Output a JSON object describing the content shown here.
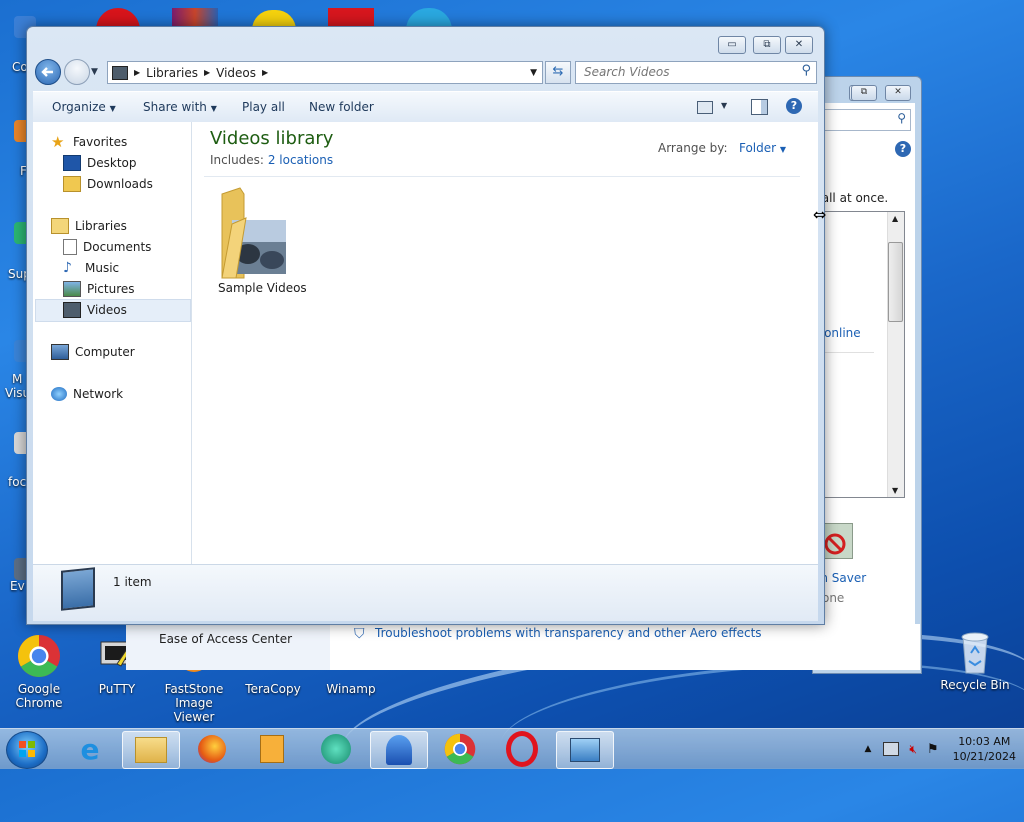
{
  "desktop": {
    "icons": [
      {
        "label": "Google\nChrome",
        "name": "google-chrome"
      },
      {
        "label": "PuTTY",
        "name": "putty"
      },
      {
        "label": "FastStone\nImage Viewer",
        "name": "faststone-image-viewer"
      },
      {
        "label": "TeraCopy",
        "name": "teracopy"
      },
      {
        "label": "Winamp",
        "name": "winamp"
      },
      {
        "label": "Recycle Bin",
        "name": "recycle-bin"
      }
    ],
    "edge_labels": [
      "Co",
      "F",
      "Sup",
      "M",
      "Visu",
      "foc",
      "Ev"
    ]
  },
  "control_panel": {
    "partial_text": "r all at once.",
    "link_online": "s online",
    "screen_saver": "en Saver",
    "none": "None",
    "ease_of_access": "Ease of Access Center",
    "troubleshoot": "Troubleshoot problems with transparency and other Aero effects"
  },
  "explorer": {
    "breadcrumb": [
      "Libraries",
      "Videos"
    ],
    "search_placeholder": "Search Videos",
    "toolbar": {
      "organize": "Organize",
      "share_with": "Share with",
      "play_all": "Play all",
      "new_folder": "New folder"
    },
    "nav": {
      "favorites": "Favorites",
      "desktop": "Desktop",
      "downloads": "Downloads",
      "libraries": "Libraries",
      "documents": "Documents",
      "music": "Music",
      "pictures": "Pictures",
      "videos": "Videos",
      "computer": "Computer",
      "network": "Network"
    },
    "library_title": "Videos library",
    "includes_label": "Includes:",
    "includes_link": "2 locations",
    "arrange_by_label": "Arrange by:",
    "arrange_by_value": "Folder",
    "items": [
      {
        "label": "Sample Videos"
      }
    ],
    "status": "1 item"
  },
  "taskbar": {
    "clock_time": "10:03 AM",
    "clock_date": "10/21/2024"
  },
  "colors": {
    "library_title": "#1e5d12",
    "link": "#1a5fb4"
  }
}
